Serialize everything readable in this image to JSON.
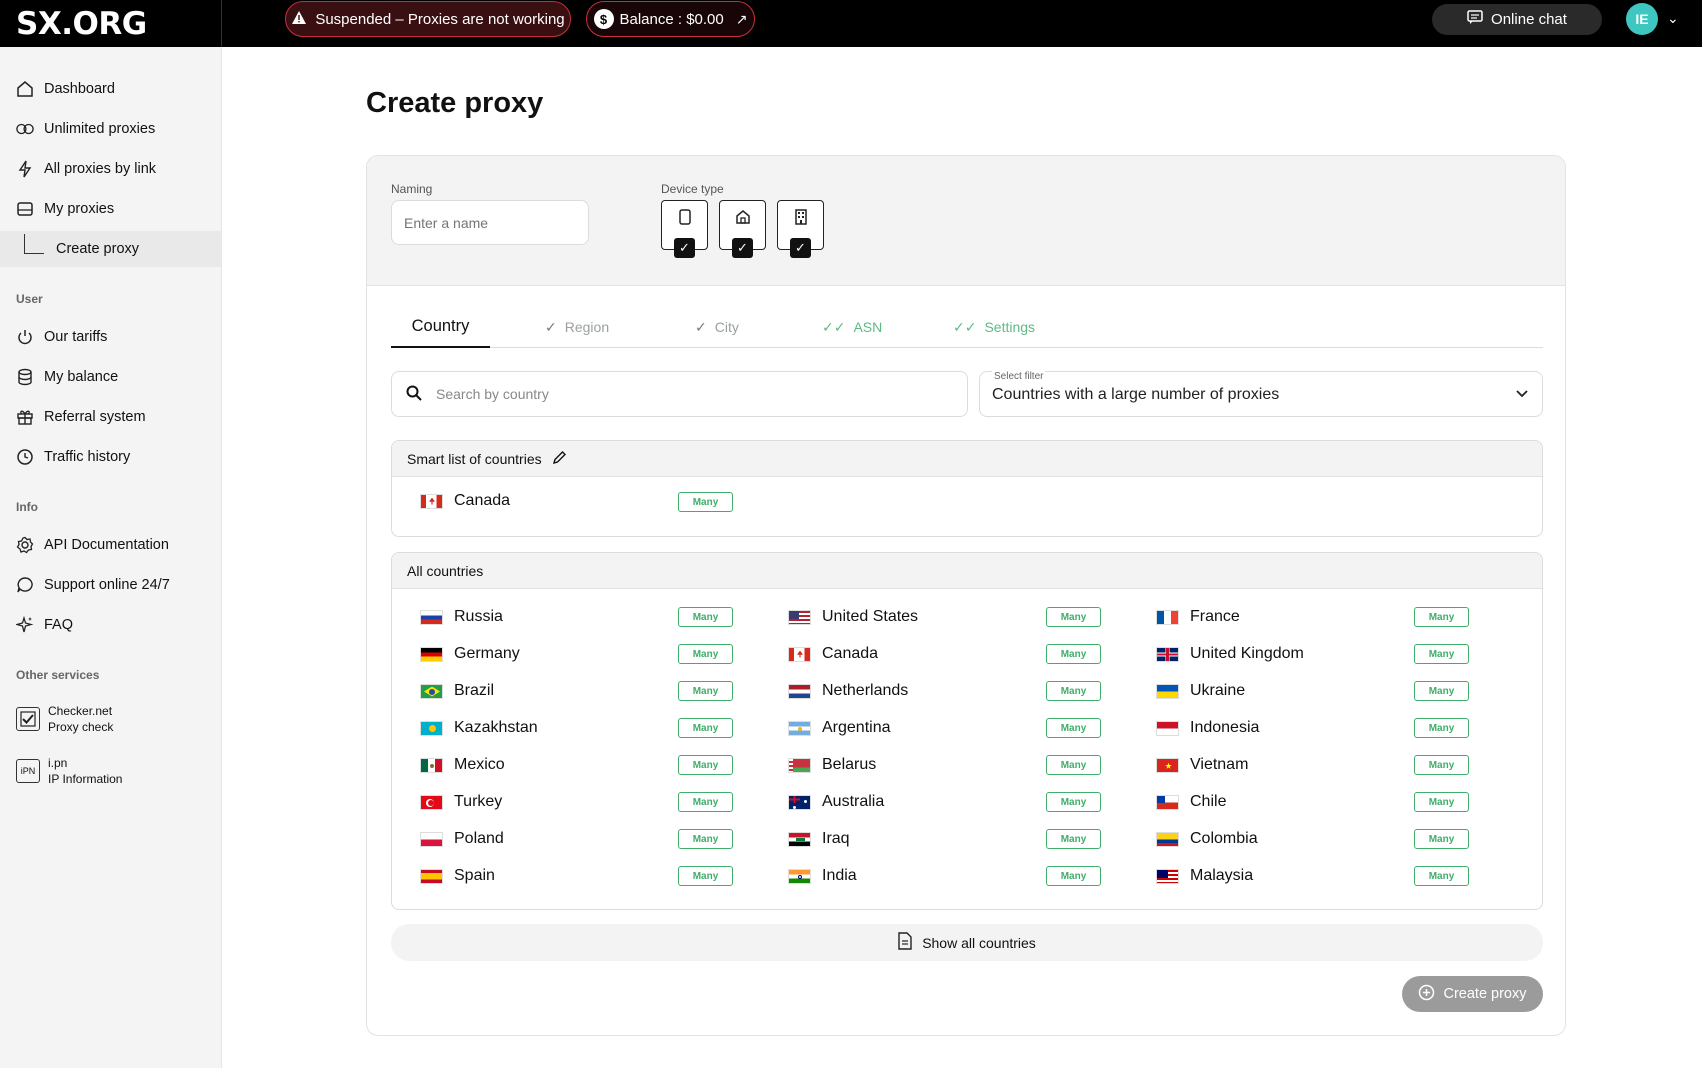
{
  "header": {
    "logo": "SX.ORG",
    "suspended_label": "Suspended – Proxies are not working",
    "balance_label": "Balance : $0.00",
    "online_chat_label": "Online chat",
    "avatar_initials": "IE"
  },
  "sidebar": {
    "items": [
      {
        "label": "Dashboard",
        "icon": "home-icon"
      },
      {
        "label": "Unlimited proxies",
        "icon": "infinity-icon"
      },
      {
        "label": "All proxies by link",
        "icon": "lightning-icon"
      },
      {
        "label": "My proxies",
        "icon": "server-icon"
      },
      {
        "label": "Create proxy",
        "icon": "sub-branch"
      }
    ],
    "user_section": "User",
    "user_items": [
      {
        "label": "Our tariffs",
        "icon": "power-icon"
      },
      {
        "label": "My balance",
        "icon": "database-icon"
      },
      {
        "label": "Referral system",
        "icon": "gift-icon"
      },
      {
        "label": "Traffic history",
        "icon": "clock-icon"
      }
    ],
    "info_section": "Info",
    "info_items": [
      {
        "label": "API Documentation",
        "icon": "gear-icon"
      },
      {
        "label": "Support online 24/7",
        "icon": "chat-bubble-icon"
      },
      {
        "label": "FAQ",
        "icon": "sparkle-icon"
      }
    ],
    "other_section": "Other services",
    "services": [
      {
        "line1": "Checker.net",
        "line2": "Proxy check"
      },
      {
        "line1": "i.pn",
        "line2": "IP Information",
        "logo": "iPN"
      }
    ]
  },
  "main": {
    "title": "Create proxy",
    "naming_label": "Naming",
    "naming_placeholder": "Enter a name",
    "device_type_label": "Device type",
    "tabs": [
      "Country",
      "Region",
      "City",
      "ASN",
      "Settings"
    ],
    "search_placeholder": "Search by country",
    "filter_small_label": "Select filter",
    "filter_value": "Countries with a large number of proxies",
    "smart_list_title": "Smart list of countries",
    "smart_list": [
      {
        "name": "Canada",
        "badge": "Many"
      }
    ],
    "all_countries_title": "All countries",
    "columns": [
      [
        {
          "name": "Russia",
          "badge": "Many"
        },
        {
          "name": "Germany",
          "badge": "Many"
        },
        {
          "name": "Brazil",
          "badge": "Many"
        },
        {
          "name": "Kazakhstan",
          "badge": "Many"
        },
        {
          "name": "Mexico",
          "badge": "Many"
        },
        {
          "name": "Turkey",
          "badge": "Many"
        },
        {
          "name": "Poland",
          "badge": "Many"
        },
        {
          "name": "Spain",
          "badge": "Many"
        }
      ],
      [
        {
          "name": "United States",
          "badge": "Many"
        },
        {
          "name": "Canada",
          "badge": "Many"
        },
        {
          "name": "Netherlands",
          "badge": "Many"
        },
        {
          "name": "Argentina",
          "badge": "Many"
        },
        {
          "name": "Belarus",
          "badge": "Many"
        },
        {
          "name": "Australia",
          "badge": "Many"
        },
        {
          "name": "Iraq",
          "badge": "Many"
        },
        {
          "name": "India",
          "badge": "Many"
        }
      ],
      [
        {
          "name": "France",
          "badge": "Many"
        },
        {
          "name": "United Kingdom",
          "badge": "Many"
        },
        {
          "name": "Ukraine",
          "badge": "Many"
        },
        {
          "name": "Indonesia",
          "badge": "Many"
        },
        {
          "name": "Vietnam",
          "badge": "Many"
        },
        {
          "name": "Chile",
          "badge": "Many"
        },
        {
          "name": "Colombia",
          "badge": "Many"
        },
        {
          "name": "Malaysia",
          "badge": "Many"
        }
      ]
    ],
    "show_all_label": "Show all countries",
    "create_button_label": "Create proxy"
  },
  "colors": {
    "accent_green": "#3fae6a",
    "alert_red": "#c7303a",
    "avatar_teal": "#3ec6c0",
    "disabled_button": "#9b9b9b"
  }
}
